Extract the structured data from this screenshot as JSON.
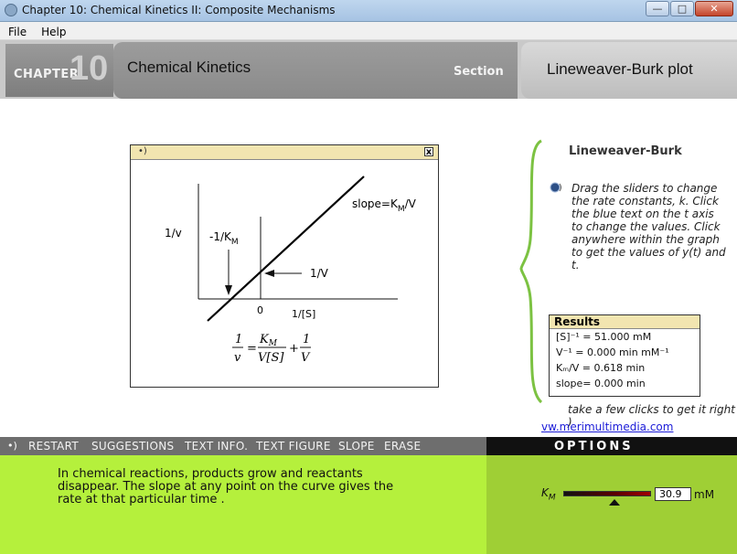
{
  "window": {
    "title": "Chapter 10: Chemical Kinetics II: Composite Mechanisms",
    "minimize_glyph": "—",
    "maximize_glyph": "□",
    "close_glyph": "✕"
  },
  "menu": {
    "items": [
      "File",
      "Help"
    ]
  },
  "header": {
    "chapter_label": "CHAPTER",
    "chapter_number": "10",
    "title": "Chemical Kinetics",
    "section_label": "Section",
    "section_title": "Lineweaver-Burk plot"
  },
  "graph": {
    "speaker_glyph": "•)",
    "close_glyph": "x",
    "y_axis_label": "1/v",
    "km_label": "-1/K",
    "km_sub": "M",
    "slope_label": "slope=K",
    "slope_sub": "M",
    "slope_tail": "/V",
    "intercept_label": "1/V",
    "zero_label": "0",
    "x_axis_label": "1/[S]",
    "eq_lhs_num": "1",
    "eq_lhs_den": "v",
    "eq_equals": "=",
    "eq_mid_num": "K",
    "eq_mid_num_sub": "M",
    "eq_mid_den": "V[S]",
    "eq_plus": "+",
    "eq_rhs_num": "1",
    "eq_rhs_den": "V"
  },
  "panel": {
    "title": "Lineweaver-Burk",
    "instructions": "Drag the sliders to change the rate constants, k. Click the blue text on the t axis to change the values. Click anywhere within the graph to get the values of y(t) and t.",
    "hint": "take a few clicks to get it right )",
    "link": "vw.merimultimedia.com"
  },
  "results": {
    "header": "Results",
    "rows": [
      "[S]⁻¹ = 51.000 mM",
      "V⁻¹  = 0.000 min mM⁻¹",
      "Kₘ/V =   0.618 min",
      "slope= 0.000 min"
    ]
  },
  "nav": {
    "speaker_glyph": "•)",
    "items": [
      "RESTART",
      "SUGGESTIONS",
      "TEXT INFO.",
      "TEXT FIGURE",
      "SLOPE",
      "ERASE"
    ]
  },
  "options": {
    "label": "OPTIONS"
  },
  "bottom": {
    "text": "In chemical reactions, products grow and reactants disappear.  The slope at any point on the curve gives the rate at that particular time ."
  },
  "km_control": {
    "label": "K",
    "label_sub": "M",
    "value": "30.9",
    "unit": "mM"
  },
  "colors": {
    "options_bg": "#111111",
    "bottom_green": "#b5f03c",
    "results_header": "#f2e5b0",
    "link": "#1b1bd8"
  }
}
